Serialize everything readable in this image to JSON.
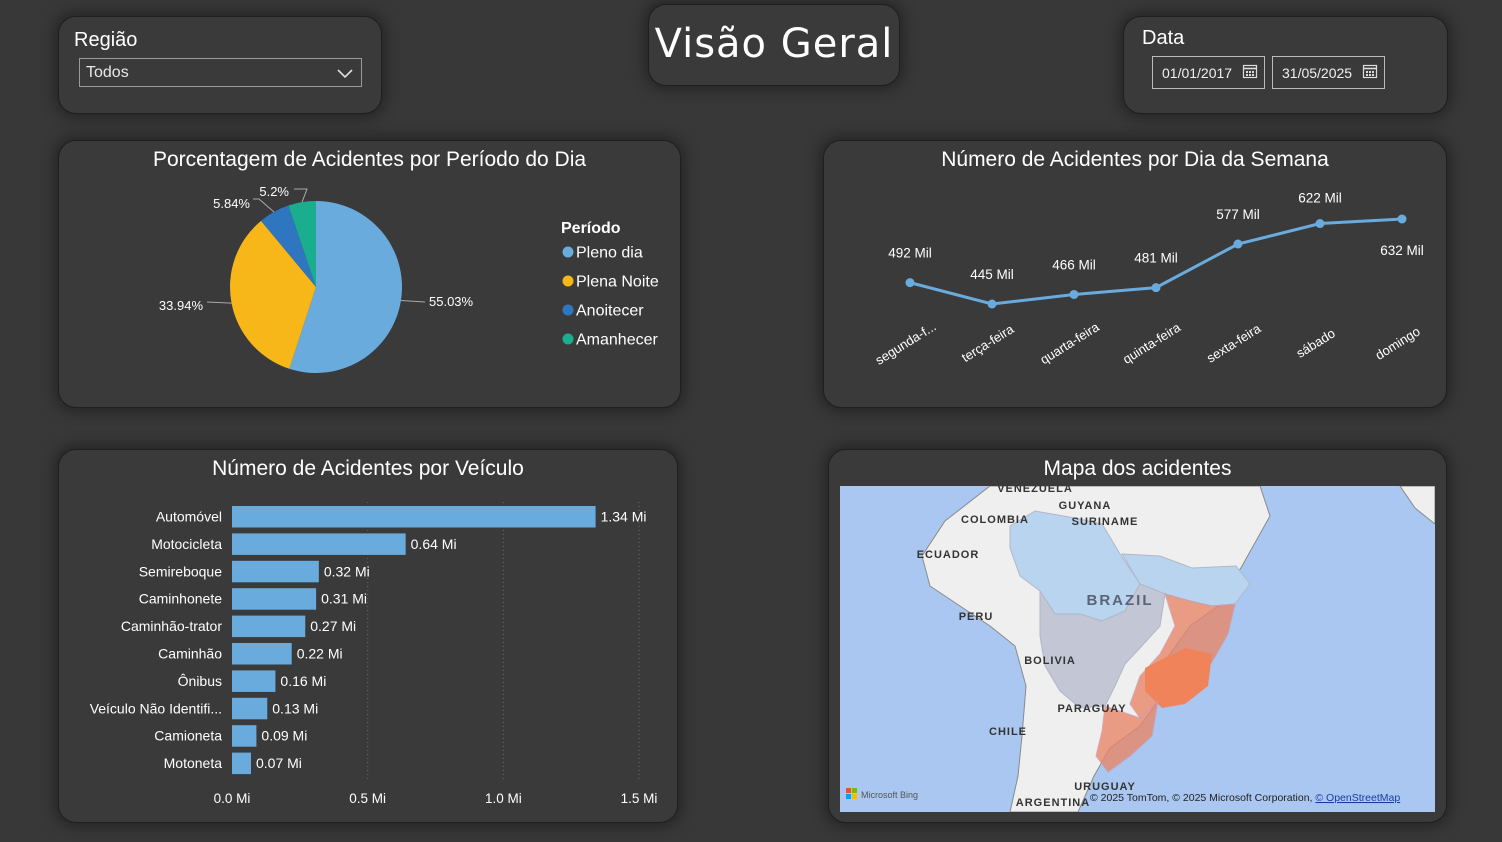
{
  "filters": {
    "region": {
      "label": "Região",
      "value": "Todos"
    },
    "date": {
      "label": "Data",
      "start": "01/01/2017",
      "end": "31/05/2025"
    }
  },
  "page_title": "Visão Geral",
  "pie": {
    "title": "Porcentagem de Acidentes por Período do Dia",
    "legend_title": "Período"
  },
  "week": {
    "title": "Número de Acidentes por Dia da Semana"
  },
  "bars": {
    "title": "Número de Acidentes por Veículo"
  },
  "map": {
    "title": "Mapa dos acidentes",
    "labels": [
      "VENEZUELA",
      "GUYANA",
      "SURINAME",
      "COLOMBIA",
      "ECUADOR",
      "BRAZIL",
      "PERU",
      "BOLIVIA",
      "PARAGUAY",
      "CHILE",
      "URUGUAY",
      "ARGENTINA"
    ],
    "attribution": "© 2025 TomTom, © 2025 Microsoft Corporation,",
    "attribution_link": "© OpenStreetMap",
    "logo_text": "Microsoft Bing",
    "colors": {
      "water": "#a9c7f0",
      "land": "#efefef",
      "light": "#b9d4ee",
      "medium": "#c3c6d4",
      "accent": "#e8876a",
      "strong": "#f0835a"
    }
  },
  "chart_data": [
    {
      "type": "pie",
      "title": "Porcentagem de Acidentes por Período do Dia",
      "legend_title": "Período",
      "legend_position": "right",
      "slices": [
        {
          "name": "Pleno dia",
          "value": 55.03,
          "label": "55.03%",
          "color": "#6aabde"
        },
        {
          "name": "Plena Noite",
          "value": 33.94,
          "label": "33.94%",
          "color": "#f8b718"
        },
        {
          "name": "Anoitecer",
          "value": 5.84,
          "label": "5.84%",
          "color": "#2e77c0"
        },
        {
          "name": "Amanhecer",
          "value": 5.2,
          "label": "5.2%",
          "color": "#1aae8f"
        }
      ]
    },
    {
      "type": "line",
      "title": "Número de Acidentes por Dia da Semana",
      "categories": [
        "segunda-f...",
        "terça-feira",
        "quarta-feira",
        "quinta-feira",
        "sexta-feira",
        "sábado",
        "domingo"
      ],
      "values": [
        492000,
        445000,
        466000,
        481000,
        577000,
        622000,
        632000
      ],
      "labels": [
        "492 Mil",
        "445 Mil",
        "466 Mil",
        "481 Mil",
        "577 Mil",
        "622 Mil",
        "632 Mil"
      ],
      "color": "#6aabde"
    },
    {
      "type": "bar",
      "orientation": "horizontal",
      "title": "Número de Acidentes por Veículo",
      "categories": [
        "Automóvel",
        "Motocicleta",
        "Semireboque",
        "Caminhonete",
        "Caminhão-trator",
        "Caminhão",
        "Ônibus",
        "Veículo Não Identifi...",
        "Camioneta",
        "Motoneta"
      ],
      "values": [
        1.34,
        0.64,
        0.32,
        0.31,
        0.27,
        0.22,
        0.16,
        0.13,
        0.09,
        0.07
      ],
      "labels": [
        "1.34 Mi",
        "0.64 Mi",
        "0.32 Mi",
        "0.31 Mi",
        "0.27 Mi",
        "0.22 Mi",
        "0.16 Mi",
        "0.13 Mi",
        "0.09 Mi",
        "0.07 Mi"
      ],
      "xticks": [
        "0.0 Mi",
        "0.5 Mi",
        "1.0 Mi",
        "1.5 Mi"
      ],
      "xlim": [
        0,
        1.5
      ],
      "grid": true,
      "color": "#6aabde"
    }
  ]
}
